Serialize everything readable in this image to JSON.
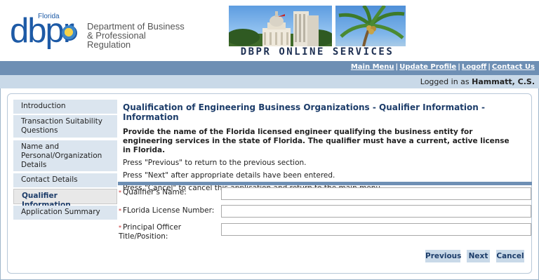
{
  "header": {
    "logo_florida": "Florida",
    "logo_dbpr": "dbpr",
    "dept_line1": "Department of Business",
    "dept_line2": "& Professional Regulation",
    "banner_title": "DBPR  ONLINE  SERVICES"
  },
  "nav": {
    "links": [
      {
        "label": "Main Menu"
      },
      {
        "label": "Update Profile"
      },
      {
        "label": "Logoff"
      },
      {
        "label": "Contact Us"
      }
    ],
    "separator": "|"
  },
  "user": {
    "logged_prefix": "Logged in as",
    "name": "Hammatt, C.S."
  },
  "sidebar": {
    "items": [
      {
        "label": "Introduction"
      },
      {
        "label": "Transaction Suitability Questions"
      },
      {
        "label": "Name and Personal/Organization Details"
      },
      {
        "label": "Contact Details"
      },
      {
        "label": "Qualifier Information",
        "active": true
      },
      {
        "label": "Application Summary"
      }
    ]
  },
  "content": {
    "title": "Qualification of Engineering Business Organizations - Qualifier Information - Information",
    "lead": "Provide the name of the Florida licensed engineer qualifying the business entity for engineering services in the state of Florida. The qualifier must have a current, active license in Florida.",
    "instructions": [
      "Press \"Previous\" to return to the previous section.",
      "Press \"Next\" after appropriate details have been entered.",
      "Press \"Cancel\" to cancel this application and return to the main menu."
    ]
  },
  "form": {
    "required_marker": "*",
    "fields": [
      {
        "label": "Qualifier's Name:",
        "value": ""
      },
      {
        "label": "FLorida License Number:",
        "value": ""
      },
      {
        "label": "Principal Officer Title/Position:",
        "value": ""
      }
    ]
  },
  "buttons": {
    "previous": "Previous",
    "next": "Next",
    "cancel": "Cancel"
  },
  "colors": {
    "nav_bar": "#6e8fb4",
    "user_bar": "#c9d9e8",
    "title_blue": "#1d3d6a",
    "logo_blue": "#1d5aa6"
  }
}
